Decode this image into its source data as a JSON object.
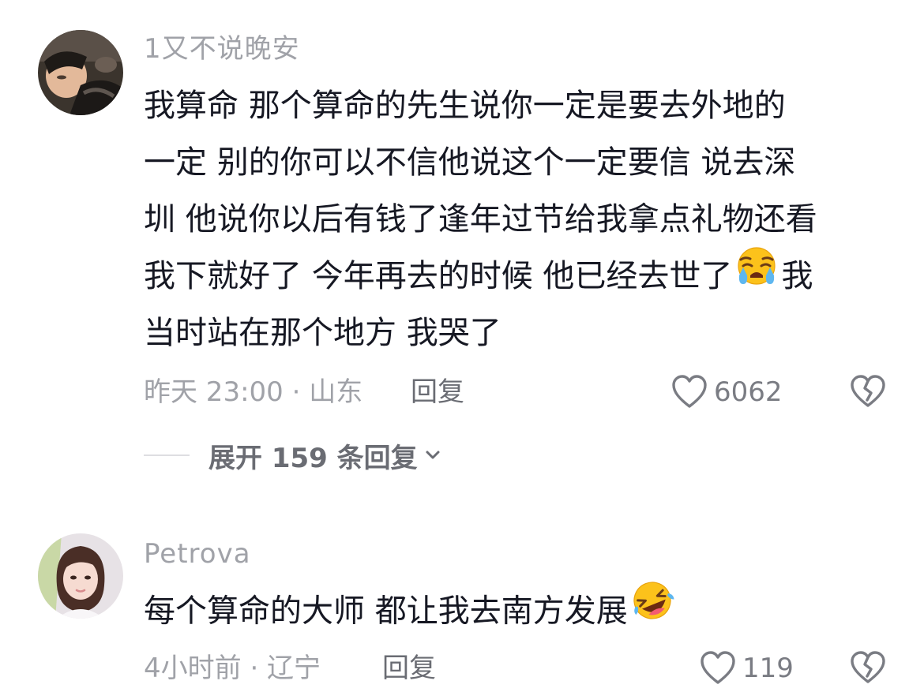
{
  "comments": [
    {
      "username": "1又不说晚安",
      "text_lines": [
        "我算命 那个算命的先生说你一定是要去外地的",
        "一定 别的你可以不信他说这个一定要信 说去深",
        "圳 他说你以后有钱了逢年过节给我拿点礼物还看",
        "我下就好了 今年再去的时候 他已经去世了",
        "当时站在那个地方 我哭了"
      ],
      "line4_after_emoji": "我",
      "emoji": "loudly-crying-face",
      "time_location": "昨天 23:00 · 山东",
      "reply_label": "回复",
      "like_count": "6062",
      "expand_label": "展开 159 条回复"
    },
    {
      "username": "Petrova",
      "text": "每个算命的大师 都让我去南方发展",
      "emoji": "rolling-on-floor-laughing",
      "time_location": "4小时前 · 辽宁",
      "reply_label": "回复",
      "like_count": "119"
    }
  ],
  "icons": {
    "like": "heart-outline-icon",
    "dislike": "broken-heart-icon",
    "expand": "chevron-down-icon"
  },
  "colors": {
    "text_primary": "#161823",
    "text_secondary": "#a0a2a8",
    "action_text": "#6a6c73",
    "icon_gray": "#7a7c83",
    "emoji_yellow": "#fcc21b",
    "tear_blue": "#5eb7f0"
  }
}
